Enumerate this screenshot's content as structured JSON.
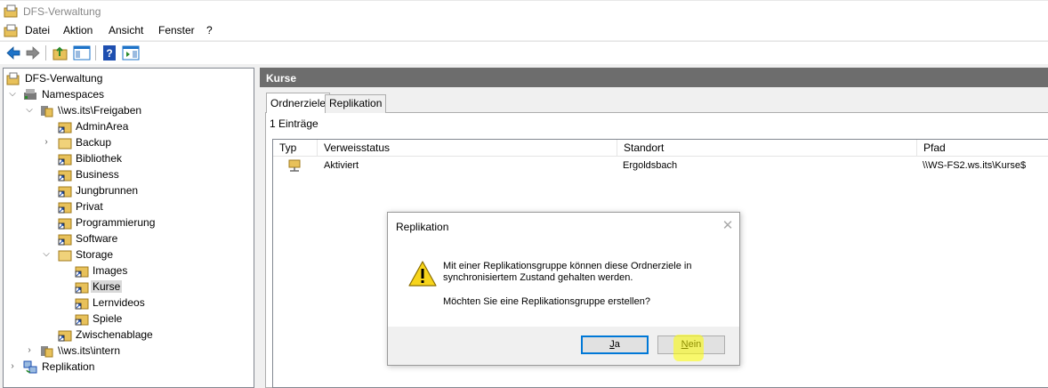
{
  "window": {
    "title": "DFS-Verwaltung"
  },
  "menu": {
    "items": [
      "Datei",
      "Aktion",
      "Ansicht",
      "Fenster",
      "?"
    ]
  },
  "tree": {
    "items": [
      {
        "label": "DFS-Verwaltung",
        "icon": "dfs-root-icon"
      },
      {
        "label": "Namespaces",
        "icon": "namespaces-icon"
      },
      {
        "label": "\\\\ws.its\\Freigaben",
        "icon": "namespace-server-icon"
      },
      {
        "label": "AdminArea",
        "icon": "folder-link-icon"
      },
      {
        "label": "Backup",
        "icon": "folder-icon"
      },
      {
        "label": "Bibliothek",
        "icon": "folder-link-icon"
      },
      {
        "label": "Business",
        "icon": "folder-link-icon"
      },
      {
        "label": "Jungbrunnen",
        "icon": "folder-link-icon"
      },
      {
        "label": "Privat",
        "icon": "folder-link-icon"
      },
      {
        "label": "Programmierung",
        "icon": "folder-link-icon"
      },
      {
        "label": "Software",
        "icon": "folder-link-icon"
      },
      {
        "label": "Storage",
        "icon": "folder-icon"
      },
      {
        "label": "Images",
        "icon": "folder-link-icon"
      },
      {
        "label": "Kurse",
        "icon": "folder-link-icon"
      },
      {
        "label": "Lernvideos",
        "icon": "folder-link-icon"
      },
      {
        "label": "Spiele",
        "icon": "folder-link-icon"
      },
      {
        "label": "Zwischenablage",
        "icon": "folder-link-icon"
      },
      {
        "label": "\\\\ws.its\\intern",
        "icon": "namespace-server-icon"
      },
      {
        "label": "Replikation",
        "icon": "replication-icon"
      }
    ]
  },
  "main": {
    "header": "Kurse",
    "tabs": [
      {
        "label": "Ordnerziele"
      },
      {
        "label": "Replikation"
      }
    ],
    "entries_count": "1 Einträge",
    "columns": [
      "Typ",
      "Verweisstatus",
      "Standort",
      "Pfad"
    ],
    "rows": [
      {
        "status": "Aktiviert",
        "location": "Ergoldsbach",
        "path": "\\\\WS-FS2.ws.its\\Kurse$"
      }
    ]
  },
  "dialog": {
    "title": "Replikation",
    "message": "Mit einer Replikationsgruppe können diese Ordnerziele in synchronisiertem Zustand gehalten werden.",
    "question": "Möchten Sie eine Replikationsgruppe erstellen?",
    "yes": {
      "label": "Ja",
      "mnemonic": "J",
      "rest": "a"
    },
    "no": {
      "label": "Nein",
      "mnemonic": "N",
      "rest": "ein"
    }
  },
  "colors": {
    "header_bg": "#6d6d6d",
    "highlight": "#ffff00",
    "focus": "#0078d7"
  }
}
